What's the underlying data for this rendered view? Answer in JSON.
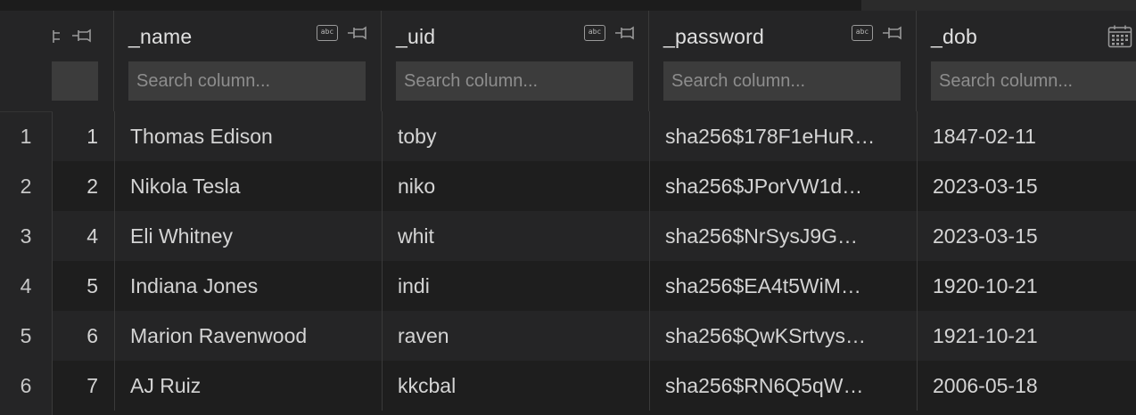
{
  "columns": [
    {
      "key": "id",
      "title": "",
      "type": "number",
      "search_placeholder": ""
    },
    {
      "key": "name",
      "title": "_name",
      "type": "text",
      "type_icon": "abc-icon",
      "search_placeholder": "Search column..."
    },
    {
      "key": "uid",
      "title": "_uid",
      "type": "text",
      "type_icon": "abc-icon",
      "search_placeholder": "Search column..."
    },
    {
      "key": "password",
      "title": "_password",
      "type": "text",
      "type_icon": "abc-icon",
      "search_placeholder": "Search column..."
    },
    {
      "key": "dob",
      "title": "_dob",
      "type": "date",
      "type_icon": "calendar-icon",
      "search_placeholder": "Search column..."
    }
  ],
  "rows": [
    {
      "rownum": "1",
      "id": "1",
      "name": "Thomas Edison",
      "uid": "toby",
      "password": "sha256$178F1eHuR…",
      "dob": "1847-02-11"
    },
    {
      "rownum": "2",
      "id": "2",
      "name": "Nikola Tesla",
      "uid": "niko",
      "password": "sha256$JPorVW1d…",
      "dob": "2023-03-15"
    },
    {
      "rownum": "3",
      "id": "4",
      "name": "Eli Whitney",
      "uid": "whit",
      "password": "sha256$NrSysJ9G…",
      "dob": "2023-03-15"
    },
    {
      "rownum": "4",
      "id": "5",
      "name": "Indiana Jones",
      "uid": "indi",
      "password": "sha256$EA4t5WiM…",
      "dob": "1920-10-21"
    },
    {
      "rownum": "5",
      "id": "6",
      "name": "Marion Ravenwood",
      "uid": "raven",
      "password": "sha256$QwKSrtvys…",
      "dob": "1921-10-21"
    },
    {
      "rownum": "6",
      "id": "7",
      "name": "AJ Ruiz",
      "uid": "kkcbal",
      "password": "sha256$RN6Q5qW…",
      "dob": "2006-05-18"
    }
  ],
  "colors": {
    "background": "#1e1e1e",
    "header": "#252526",
    "search_bg": "#3c3c3c",
    "text": "#d4d4d4"
  }
}
